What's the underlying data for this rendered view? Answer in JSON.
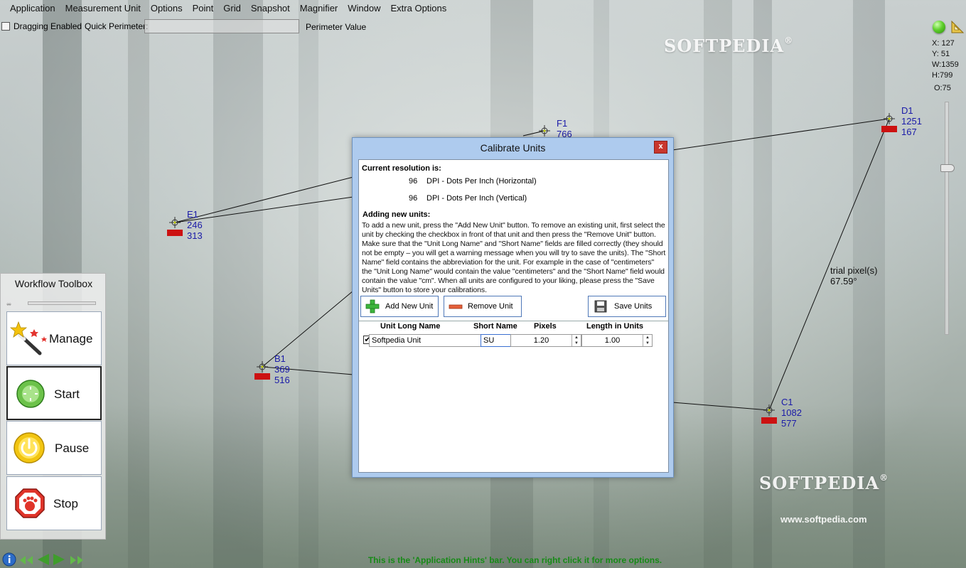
{
  "menu": [
    "Application",
    "Measurement Unit",
    "Options",
    "Point",
    "Grid",
    "Snapshot",
    "Magnifier",
    "Window",
    "Extra Options"
  ],
  "toolbar": {
    "dragging_label": "Dragging Enabled",
    "quick_perimeter_label": "Quick Perimeter:",
    "quick_perimeter_value": "",
    "perimeter_value_label": "Perimeter Value"
  },
  "info": {
    "x": "X: 127",
    "y": "Y: 51",
    "w": "W:1359",
    "h": "H:799",
    "o": "O:75"
  },
  "watermark": {
    "top": "SOFTPEDIA",
    "bottom": "SOFTPEDIA",
    "registered": "®",
    "url": "www.softpedia.com"
  },
  "points": {
    "f1": {
      "name": "F1",
      "x": "766"
    },
    "d1": {
      "name": "D1",
      "x": "1251",
      "y": "167"
    },
    "e1": {
      "name": "E1",
      "x": "246",
      "y": "313"
    },
    "b1": {
      "name": "B1",
      "x": "369",
      "y": "516"
    },
    "c1": {
      "name": "C1",
      "x": "1082",
      "y": "577"
    }
  },
  "trial": {
    "line1": "trial pixel(s)",
    "line2": "67.59°"
  },
  "toolbox": {
    "title": "Workflow Toolbox",
    "manage": "Manage",
    "start": "Start",
    "pause": "Pause",
    "stop": "Stop"
  },
  "dialog": {
    "title": "Calibrate Units",
    "close": "x",
    "current_resolution": "Current resolution is:",
    "dpi_h_value": "96",
    "dpi_h_label": "DPI  - Dots Per Inch (Horizontal)",
    "dpi_v_value": "96",
    "dpi_v_label": "DPI  - Dots Per Inch (Vertical)",
    "adding_title": "Adding new units:",
    "description": "To add a new unit, press the \"Add New Unit\" button. To remove an existing unit, first select the unit by checking the checkbox in front of that unit and then press the \"Remove Unit\" button. Make sure that the \"Unit Long Name\" and \"Short Name\" fields are filled correctly (they should not be empty – you will get a warning message when you will try to save the units). The \"Short Name\" field contains the abbreviation for the unit. For example in the case of \"centimeters\" the \"Unit Long Name\" would contain the value \"centimeters\" and the \"Short Name\" field would contain the value \"cm\". When all units are configured to your liking, please press the \"Save Units\" button to store your calibrations.",
    "add_button": "Add New Unit",
    "remove_button": "Remove Unit",
    "save_button": "Save Units",
    "columns": [
      "Unit Long Name",
      "Short Name",
      "Pixels",
      "Length in Units"
    ],
    "rows": [
      {
        "checked": "✔",
        "long_name": "Softpedia Unit",
        "short_name": "SU",
        "pixels": "1.20",
        "length": "1.00"
      }
    ]
  },
  "hint": "This is the 'Application Hints' bar. You can right click it for more options.",
  "colors": {
    "accent": "#178a17",
    "flag": "#cc1111",
    "point_label": "#1a1aa8",
    "dialog_frame": "#aecbee"
  }
}
